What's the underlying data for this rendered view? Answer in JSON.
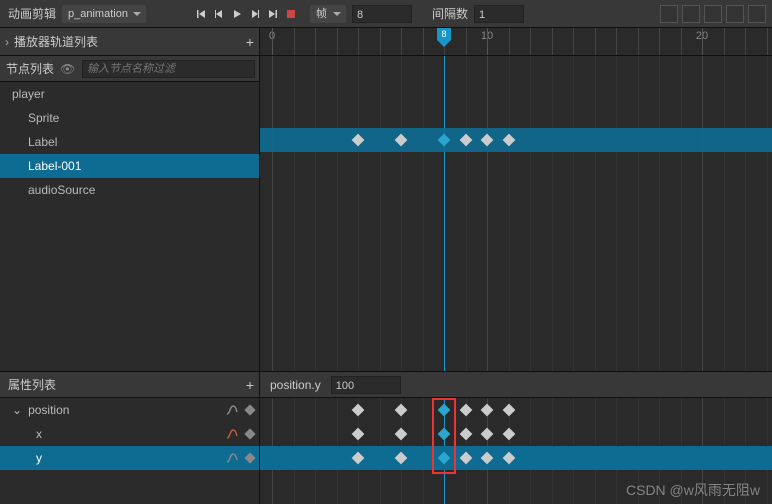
{
  "topbar": {
    "title": "动画剪辑",
    "clip": "p_animation",
    "frame_label": "帧",
    "current_frame": "8",
    "interval_label": "间隔数",
    "interval_value": "1"
  },
  "track_header": "播放器轨道列表",
  "node_list": {
    "title": "节点列表",
    "search_placeholder": "输入节点名称过滤",
    "items": [
      "player",
      "Sprite",
      "Label",
      "Label-001",
      "audioSource"
    ],
    "selected": 3
  },
  "timeline": {
    "ticks": [
      0,
      10,
      20
    ],
    "playhead_frame": 8,
    "keyframes_row": {
      "row": 3,
      "frames": [
        4,
        6,
        8,
        9,
        10,
        11
      ],
      "blue_frames": [
        8
      ]
    }
  },
  "prop_list": {
    "title": "属性列表",
    "current_label": "position.y",
    "current_value": "100",
    "rows": [
      {
        "label": "position",
        "indent": 0
      },
      {
        "label": "x",
        "indent": 1
      },
      {
        "label": "y",
        "indent": 1
      }
    ],
    "selected": 2,
    "lanes": [
      {
        "frames": [
          4,
          6,
          8,
          9,
          10,
          11
        ],
        "blue": [
          8
        ]
      },
      {
        "frames": [
          4,
          6,
          8,
          9,
          10,
          11
        ],
        "blue": [
          8
        ]
      },
      {
        "frames": [
          4,
          6,
          8,
          9,
          10,
          11
        ],
        "blue": [
          8
        ]
      }
    ]
  },
  "watermark": "CSDN @w风雨无阻w"
}
